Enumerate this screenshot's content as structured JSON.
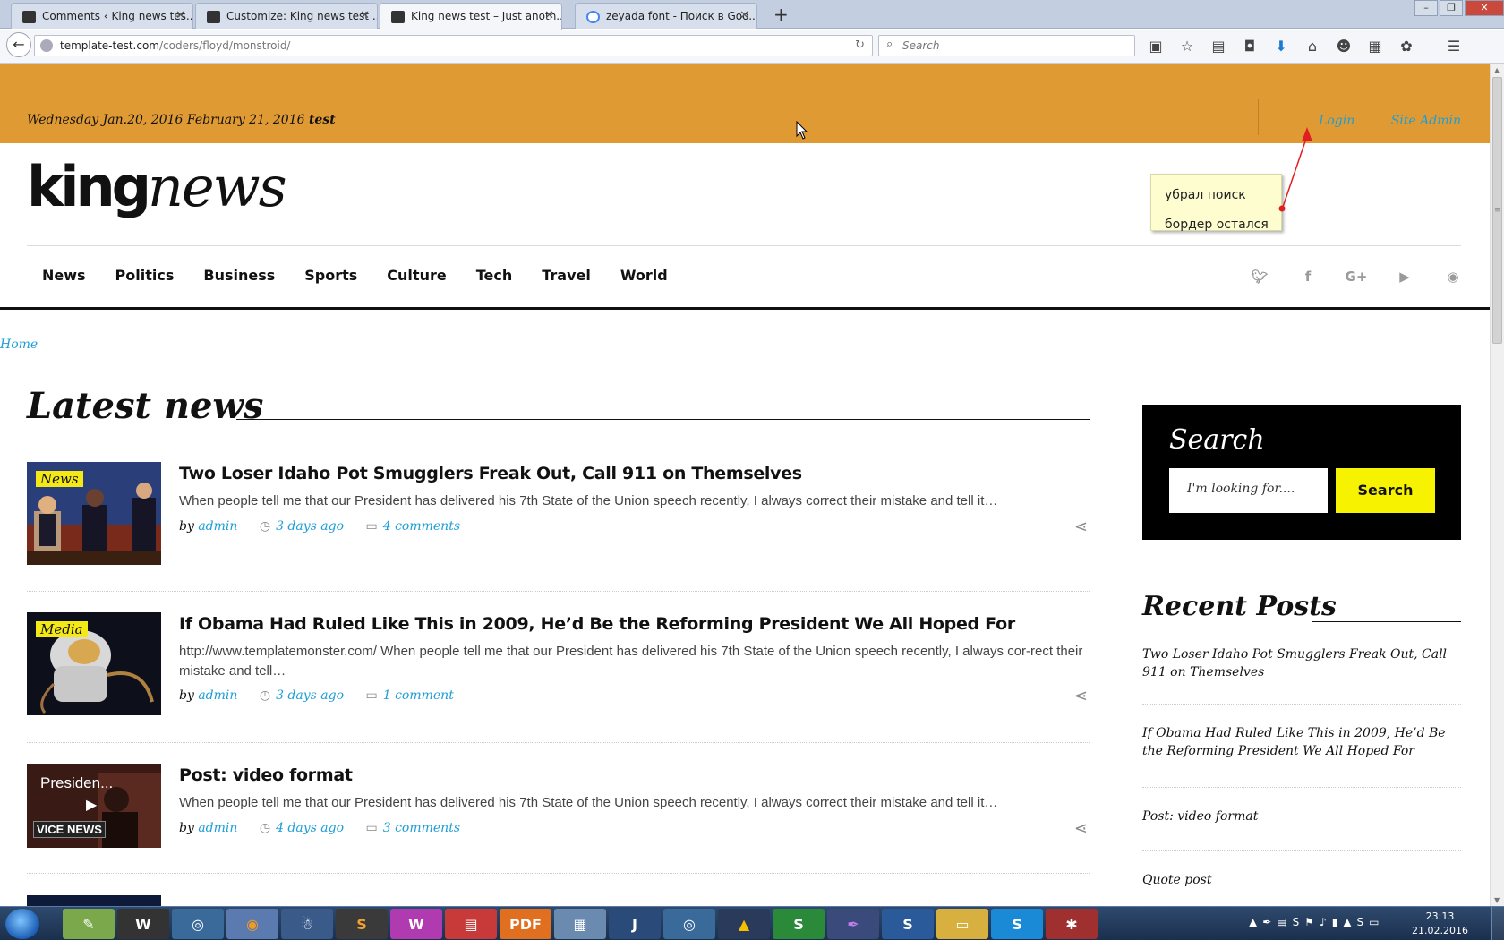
{
  "browser": {
    "tabs": [
      {
        "title": "Comments ‹ King news tes...",
        "active": false
      },
      {
        "title": "Customize: King news test ...",
        "active": false
      },
      {
        "title": "King news test – Just anoth...",
        "active": true
      },
      {
        "title": "zeyada font - Поиск в Goo...",
        "active": false
      }
    ],
    "url_host": "template-test.com",
    "url_path": "/coders/floyd/monstroid/",
    "search_placeholder": "Search"
  },
  "topbar": {
    "date_text": "Wednesday Jan.20, 2016 February 21, 2016",
    "user": "test",
    "login": "Login",
    "site_admin": "Site Admin"
  },
  "logo": {
    "king": "king",
    "news": "news"
  },
  "note": {
    "line1": "убрал поиск",
    "line2": "бордер остался"
  },
  "nav": [
    "News",
    "Politics",
    "Business",
    "Sports",
    "Culture",
    "Tech",
    "Travel",
    "World"
  ],
  "social_icons": [
    "twitter-icon",
    "facebook-icon",
    "google-plus-icon",
    "youtube-icon",
    "rss-icon"
  ],
  "breadcrumb": "Home",
  "latest_title": "Latest news",
  "posts": [
    {
      "category": "News",
      "title": "Two Loser Idaho Pot Smugglers Freak Out, Call 911 on Themselves",
      "excerpt": "When people tell me that our President has delivered his 7th State of the Union speech recently, I always correct their mistake and tell it…",
      "by": "by",
      "author": "admin",
      "date": "3 days ago",
      "comments": "4 comments"
    },
    {
      "category": "Media",
      "title": "If Obama Had Ruled Like This in 2009, He’d Be the Reforming President We All Hoped For",
      "excerpt": "http://www.templatemonster.com/ When people tell me that our President has delivered his 7th State of the Union speech recently, I always cor-rect their mistake and tell…",
      "by": "by",
      "author": "admin",
      "date": "3 days ago",
      "comments": "1 comment"
    },
    {
      "category": "",
      "video_label": "Presiden...",
      "video_brand": "VICE NEWS",
      "title": "Post: video format",
      "excerpt": "When people tell me that our President has delivered his 7th State of the Union speech recently, I always correct their mistake and tell it…",
      "by": "by",
      "author": "admin",
      "date": "4 days ago",
      "comments": "3 comments"
    }
  ],
  "sidebar": {
    "search_title": "Search",
    "search_placeholder": "I'm looking for....",
    "search_button": "Search",
    "recent_title": "Recent Posts",
    "recent": [
      "Two Loser Idaho Pot Smugglers Freak Out, Call 911 on Themselves",
      "If Obama Had Ruled Like This in 2009, He’d Be the Reforming President We All Hoped For",
      "Post: video format",
      "Quote post"
    ]
  },
  "taskbar": {
    "time": "23:13",
    "date": "21.02.2016"
  },
  "colors": {
    "topbar": "#df9a33",
    "link": "#1e9ed7",
    "category_badge": "#f4e916",
    "search_button": "#f7f300"
  }
}
